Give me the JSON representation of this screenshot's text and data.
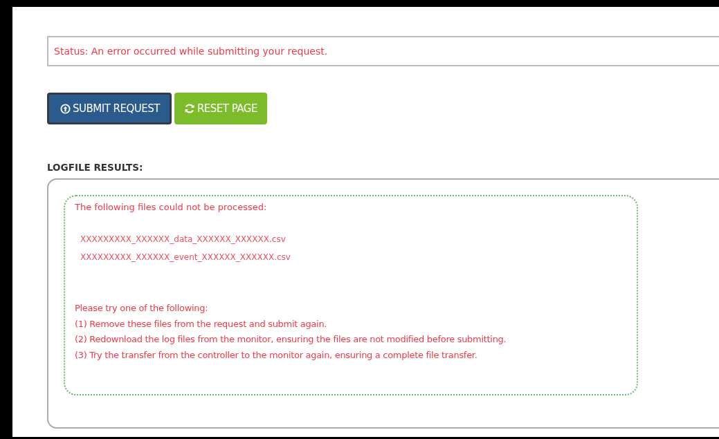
{
  "status": {
    "text": "Status: An error occurred while submitting your request."
  },
  "buttons": [
    {
      "kind": "submit",
      "label": "SUBMIT REQUEST"
    },
    {
      "kind": "reset",
      "label": "RESET PAGE"
    }
  ],
  "logfile": {
    "heading": "LOGFILE RESULTS:",
    "intro": "The following files could not be processed:",
    "files": [
      "XXXXXXXXX_XXXXXX_data_XXXXXX_XXXXXX.csv",
      "XXXXXXXXX_XXXXXX_event_XXXXXX_XXXXXX.csv"
    ],
    "advice": [
      "Please try one of the following:",
      "(1) Remove these files from the request and submit again.",
      "(2) Redownload the log files from the monitor, ensuring the files are not modified before submitting.",
      "(3) Try the transfer from the controller to the monitor again, ensuring a complete file transfer."
    ]
  }
}
